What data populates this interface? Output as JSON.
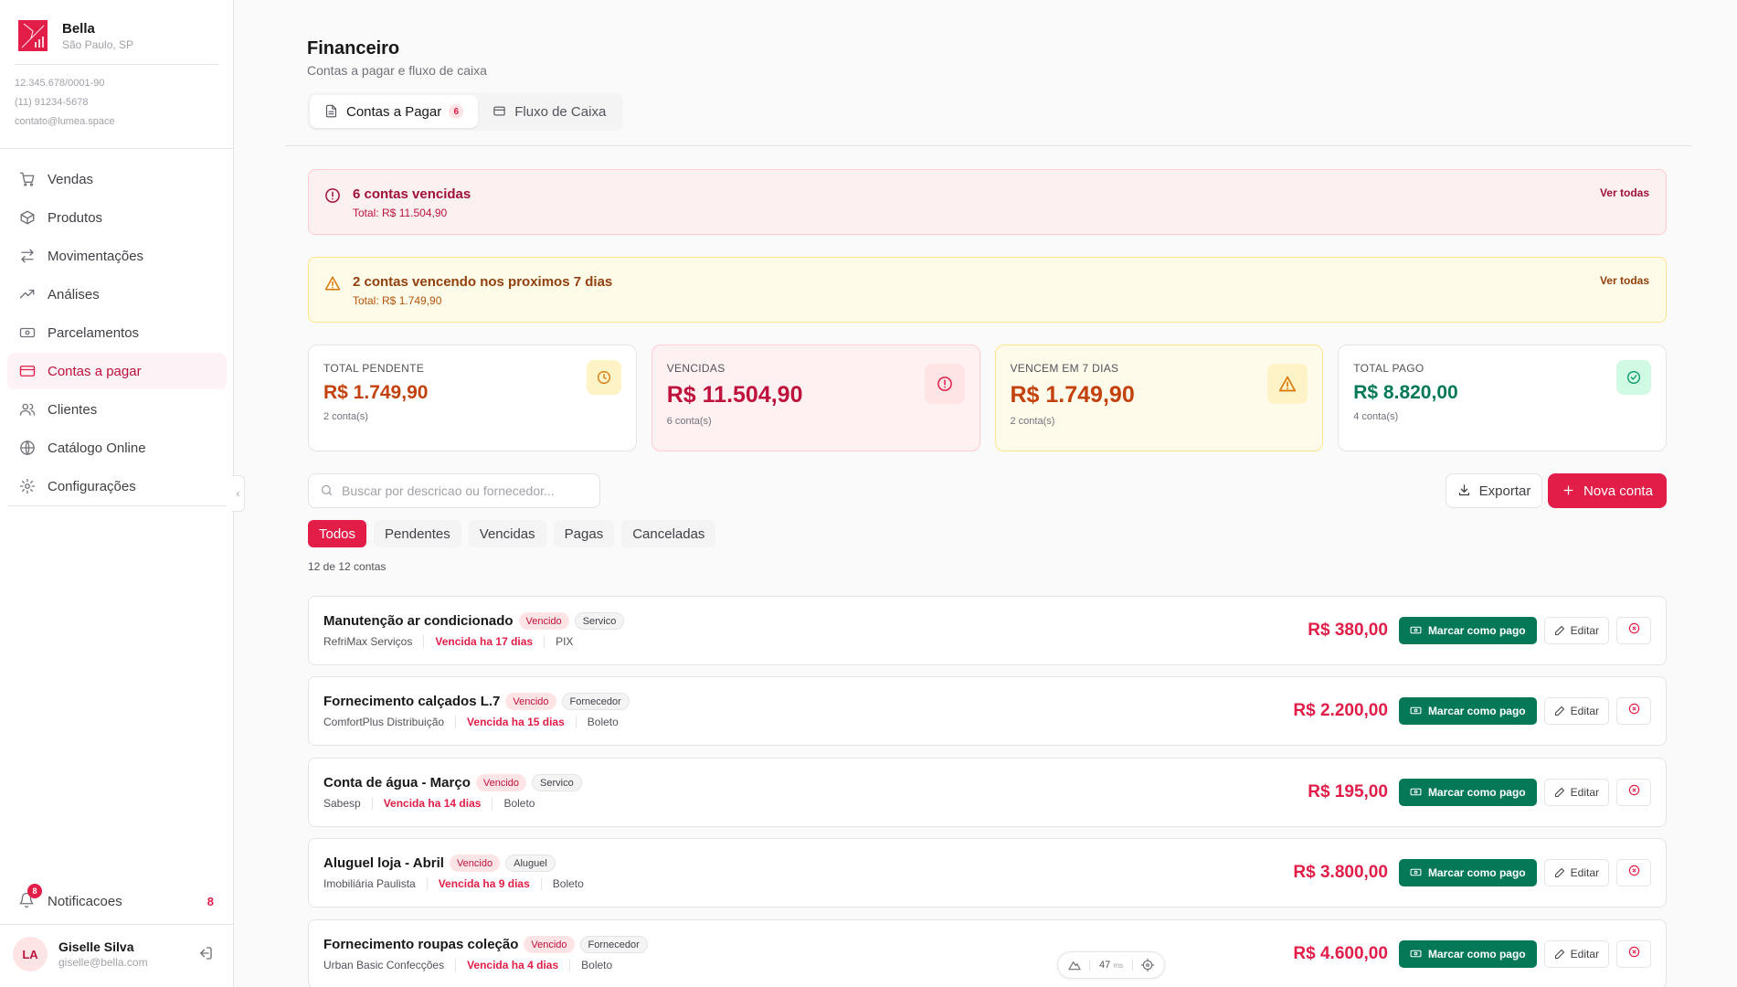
{
  "brand": {
    "name": "Bella",
    "city": "São Paulo, SP",
    "cnpj": "12.345.678/0001-90",
    "phone": "(11) 91234-5678",
    "email": "contato@lumea.space"
  },
  "nav": {
    "items": [
      {
        "label": "Vendas",
        "icon": "cart-icon"
      },
      {
        "label": "Produtos",
        "icon": "box-icon"
      },
      {
        "label": "Movimentações",
        "icon": "arrows-icon"
      },
      {
        "label": "Análises",
        "icon": "trend-icon"
      },
      {
        "label": "Parcelamentos",
        "icon": "banknote-icon"
      },
      {
        "label": "Contas a pagar",
        "icon": "credit-card-icon",
        "active": true
      },
      {
        "label": "Clientes",
        "icon": "users-icon"
      },
      {
        "label": "Catálogo Online",
        "icon": "globe-icon"
      },
      {
        "label": "Configurações",
        "icon": "gear-icon"
      }
    ]
  },
  "notifications": {
    "label": "Notificacoes",
    "badge": "8",
    "count": "8"
  },
  "user": {
    "initials": "LA",
    "name": "Giselle Silva",
    "email": "giselle@bella.com"
  },
  "page": {
    "title": "Financeiro",
    "subtitle": "Contas a pagar e fluxo de caixa",
    "tabs": [
      {
        "label": "Contas a Pagar",
        "badge": "6",
        "active": true
      },
      {
        "label": "Fluxo de Caixa"
      }
    ]
  },
  "alerts": {
    "overdue": {
      "title": "6 contas vencidas",
      "total": "Total: R$ 11.504,90",
      "link": "Ver todas"
    },
    "upcoming": {
      "title": "2 contas vencendo nos proximos 7 dias",
      "total": "Total: R$ 1.749,90",
      "link": "Ver todas"
    }
  },
  "stats": [
    {
      "label": "TOTAL PENDENTE",
      "value": "R$ 1.749,90",
      "count": "2 conta(s)",
      "color": "#c2410c"
    },
    {
      "label": "VENCIDAS",
      "value": "R$ 11.504,90",
      "count": "6 conta(s)",
      "color": "#be123c"
    },
    {
      "label": "VENCEM EM 7 DIAS",
      "value": "R$ 1.749,90",
      "count": "2 conta(s)",
      "color": "#c2410c"
    },
    {
      "label": "TOTAL PAGO",
      "value": "R$ 8.820,00",
      "count": "4 conta(s)",
      "color": "#047857"
    }
  ],
  "toolbar": {
    "search_placeholder": "Buscar por descricao ou fornecedor...",
    "export_label": "Exportar",
    "new_label": "Nova conta"
  },
  "filters": [
    "Todos",
    "Pendentes",
    "Vencidas",
    "Pagas",
    "Canceladas"
  ],
  "count_text": "12 de 12 contas",
  "bills": [
    {
      "title": "Manutenção ar condicionado",
      "status": "Vencido",
      "category": "Servico",
      "supplier": "RefriMax Serviços",
      "due": "Vencida ha 17 dias",
      "method": "PIX",
      "amount": "R$ 380,00"
    },
    {
      "title": "Fornecimento calçados L.7",
      "status": "Vencido",
      "category": "Fornecedor",
      "supplier": "ComfortPlus Distribuição",
      "due": "Vencida ha 15 dias",
      "method": "Boleto",
      "amount": "R$ 2.200,00"
    },
    {
      "title": "Conta de água - Março",
      "status": "Vencido",
      "category": "Servico",
      "supplier": "Sabesp",
      "due": "Vencida ha 14 dias",
      "method": "Boleto",
      "amount": "R$ 195,00"
    },
    {
      "title": "Aluguel loja - Abril",
      "status": "Vencido",
      "category": "Aluguel",
      "supplier": "Imobiliária Paulista",
      "due": "Vencida ha 9 dias",
      "method": "Boleto",
      "amount": "R$ 3.800,00"
    },
    {
      "title": "Fornecimento roupas coleção",
      "status": "Vencido",
      "category": "Fornecedor",
      "supplier": "Urban Basic Confecções",
      "due": "Vencida ha 4 dias",
      "method": "Boleto",
      "amount": "R$ 4.600,00"
    }
  ],
  "bill_actions": {
    "pay_label": "Marcar como pago",
    "edit_label": "Editar"
  },
  "perf": {
    "value": "47",
    "unit": "ms"
  },
  "colors": {
    "accent": "#e11d48",
    "success": "#047857",
    "warning": "#d97706"
  }
}
